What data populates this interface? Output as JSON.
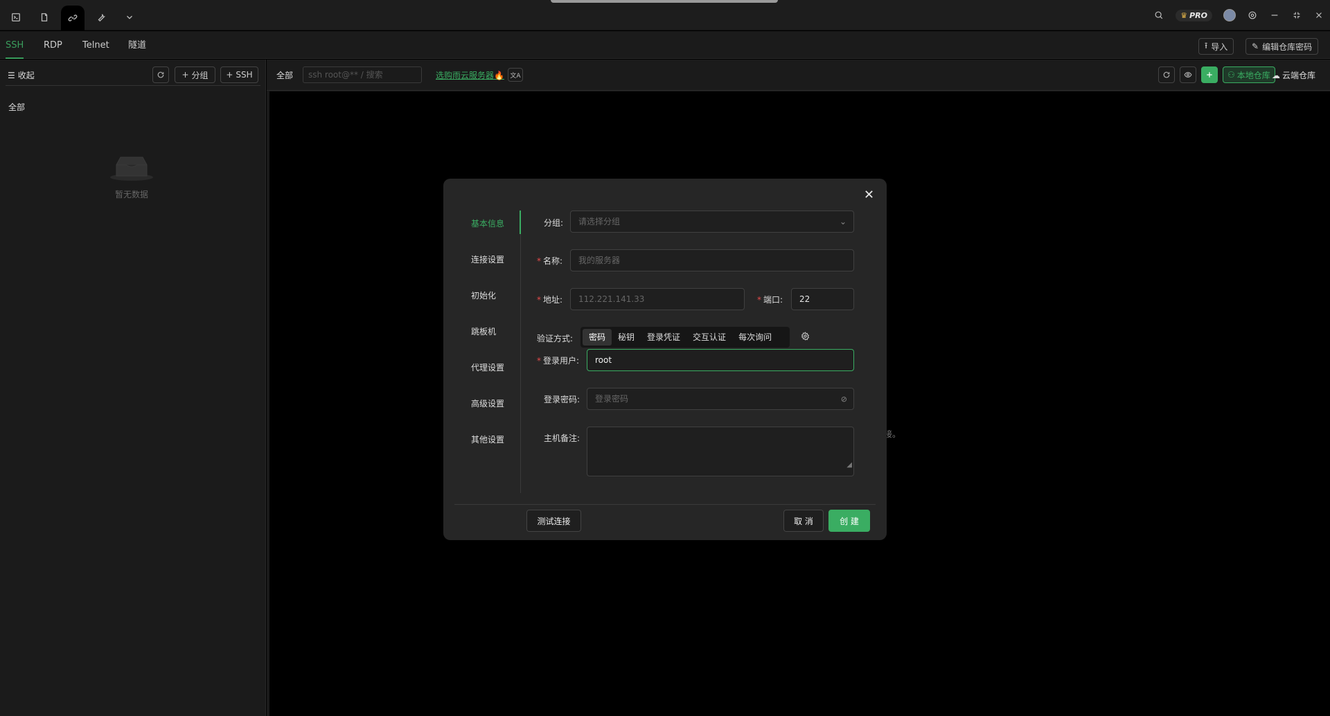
{
  "titlebar": {
    "pro_label": "PRO"
  },
  "protocol_tabs": [
    "SSH",
    "RDP",
    "Telnet",
    "隧道"
  ],
  "header_actions": {
    "import_label": "导入",
    "edit_vault_password_label": "编辑仓库密码"
  },
  "left_panel": {
    "collapse_label": "收起",
    "add_group_label": "分组",
    "add_ssh_label": "SSH",
    "all_label": "全部",
    "empty_label": "暂无数据"
  },
  "main_toolbar": {
    "all_label": "全部",
    "search_placeholder": "ssh root@** / 搜索",
    "promo_link": "选购雨云服务器",
    "promo_emoji": "🔥",
    "local_vault_label": "本地仓库",
    "cloud_vault_label": "云端仓库"
  },
  "background_text": "接。",
  "dialog": {
    "nav": [
      "基本信息",
      "连接设置",
      "初始化",
      "跳板机",
      "代理设置",
      "高级设置",
      "其他设置"
    ],
    "active_nav": "基本信息",
    "fields": {
      "group_label": "分组:",
      "group_placeholder": "请选择分组",
      "name_label": "名称:",
      "name_placeholder": "我的服务器",
      "address_label": "地址:",
      "address_placeholder": "112.221.141.33",
      "port_label": "端口:",
      "port_value": "22",
      "auth_label": "验证方式:",
      "auth_options": [
        "密码",
        "秘钥",
        "登录凭证",
        "交互认证",
        "每次询问"
      ],
      "auth_selected": "密码",
      "user_label": "登录用户:",
      "user_value": "root",
      "password_label": "登录密码:",
      "password_placeholder": "登录密码",
      "note_label": "主机备注:"
    },
    "buttons": {
      "test": "测试连接",
      "cancel": "取 消",
      "create": "创 建"
    }
  },
  "colors": {
    "accent": "#3aad62",
    "required": "#e54b4b",
    "background": "#000000",
    "panel": "#1b1b1b",
    "dialog": "#262626"
  }
}
